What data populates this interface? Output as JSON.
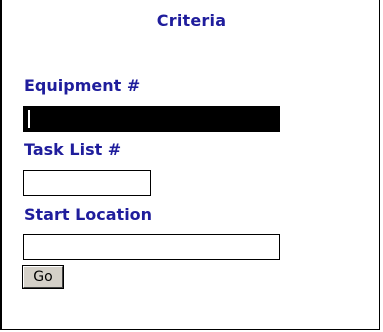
{
  "form": {
    "title": "Criteria",
    "equipment": {
      "label": "Equipment #",
      "value": ""
    },
    "task_list": {
      "label": "Task List #",
      "value": ""
    },
    "start_location": {
      "label": "Start Location",
      "value": ""
    },
    "go_label": "Go"
  },
  "colors": {
    "label_text": "#1f1d9c",
    "focused_field_bg": "#000000",
    "button_bg": "#d4d0c8"
  }
}
